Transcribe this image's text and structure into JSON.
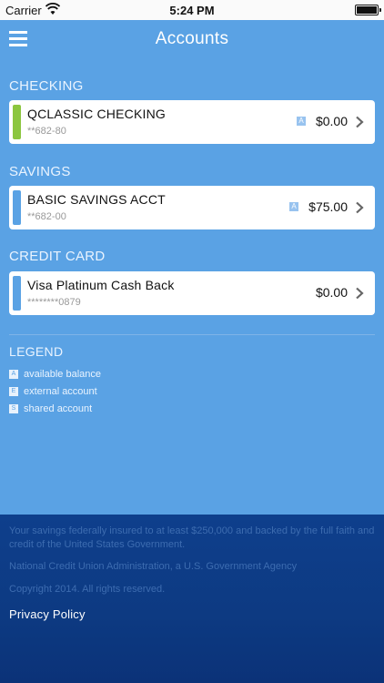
{
  "status_bar": {
    "carrier": "Carrier",
    "time": "5:24 PM"
  },
  "nav": {
    "title": "Accounts"
  },
  "sections": {
    "checking": {
      "header": "CHECKING",
      "account": {
        "name": "QCLASSIC CHECKING",
        "number": "**682-80",
        "badge": "A",
        "balance": "$0.00",
        "color": "#8cc63f"
      }
    },
    "savings": {
      "header": "SAVINGS",
      "account": {
        "name": "BASIC SAVINGS ACCT",
        "number": "**682-00",
        "badge": "A",
        "balance": "$75.00",
        "color": "#5aa2e4"
      }
    },
    "credit_card": {
      "header": "CREDIT CARD",
      "account": {
        "name": "Visa Platinum Cash Back",
        "number": "********0879",
        "balance": "$0.00",
        "color": "#5aa2e4"
      }
    }
  },
  "legend": {
    "title": "LEGEND",
    "items": [
      {
        "key": "A",
        "label": "available balance"
      },
      {
        "key": "E",
        "label": "external account"
      },
      {
        "key": "S",
        "label": "shared account"
      }
    ]
  },
  "footer": {
    "disclaimer": "Your savings federally insured to at least $250,000 and backed by the full faith and credit of the United States Government.",
    "ncua": "National Credit Union Administration, a U.S. Government Agency",
    "copyright": "Copyright 2014. All rights reserved.",
    "privacy_link": "Privacy Policy"
  },
  "colors": {
    "background": "#5aa2e4",
    "footer": "#0e3f8c",
    "checking_accent": "#8cc63f",
    "account_accent": "#5aa2e4"
  }
}
